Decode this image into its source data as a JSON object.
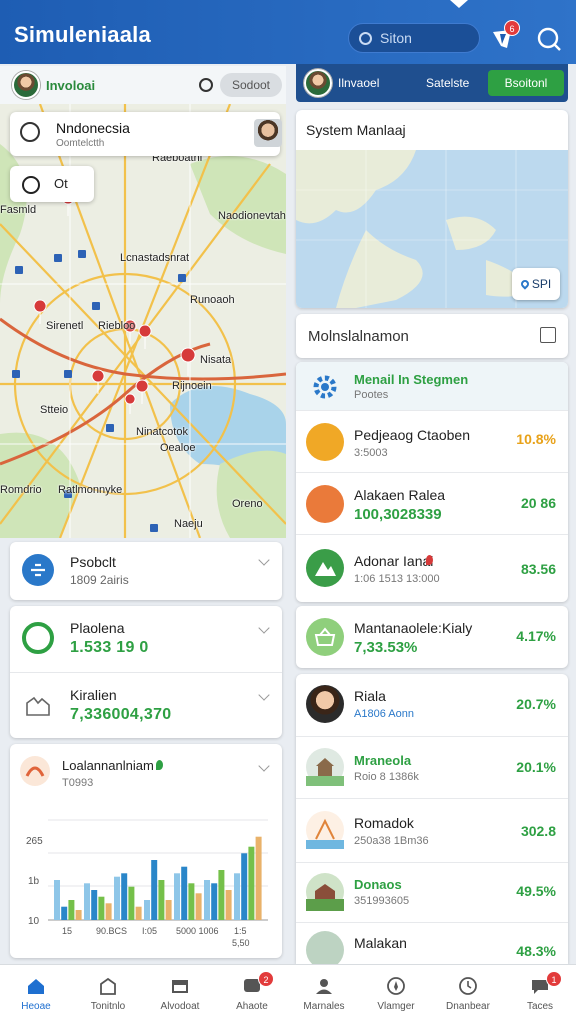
{
  "header": {
    "title": "Simuleniaala",
    "search_placeholder": "Siton",
    "notif_count": "6"
  },
  "left_top": {
    "user_name": "Involoai",
    "pill_label": "Sodoot"
  },
  "map": {
    "location_title": "Nndonecsia",
    "location_sub": "Oomtelctth",
    "mini_label": "Ot",
    "labels": [
      "Raeboathi",
      "Fasmld",
      "Naodionevtah",
      "Lcnastadsnrat",
      "Sirenetl",
      "Riebloo",
      "Runoaoh",
      "Nisata",
      "Rijnoein",
      "Ninatcotok",
      "Stteio",
      "Romdrio",
      "Ratlmonnyke",
      "Naeju",
      "Oealoe",
      "Oreno"
    ]
  },
  "left_cards": [
    {
      "title": "Psobclt",
      "sub": "1809 2airis"
    },
    {
      "title": "Plaolena",
      "value": "1.533 19 0"
    },
    {
      "title": "Kiralien",
      "value": "7,336004,370"
    }
  ],
  "chart_card": {
    "title": "Loalannanlniam",
    "sub": "T0993",
    "y_ticks": [
      "265",
      "1b",
      "10"
    ],
    "x_ticks": [
      "15",
      "90.BCS",
      "I:05",
      "5000 1006",
      "1:5",
      "5,50"
    ]
  },
  "right_top": {
    "user": "Ilnvaoel",
    "label": "Satelste",
    "button": "Bsoitonl"
  },
  "system_map": {
    "title": "System Manlaaj",
    "pill": "SPI"
  },
  "monitoring": {
    "title": "Molnslalnamon",
    "header_row": {
      "title": "Menail In Stegmen",
      "sub": "Pootes"
    },
    "rows": [
      {
        "title": "Pedjeaog Ctaoben",
        "sub": "3:5003",
        "pct": "10.8%",
        "pct_color": "#e8a21a",
        "icon_color": "#f0a826"
      },
      {
        "title": "Alakaen Ralea",
        "value": "100,3028339",
        "pct": "20 86",
        "pct_color": "#2ea043",
        "icon_color": "#ea7a3a"
      },
      {
        "title": "Adonar Ianai",
        "sub": "1:06 1513 13:000",
        "pct": "83.56",
        "pct_color": "#2ea043",
        "icon_color": "#3a9d48"
      }
    ]
  },
  "single_card": {
    "title": "Mantanaolele:Kialy",
    "value": "7,33.53%",
    "pct": "4.17%"
  },
  "people": [
    {
      "title": "Riala",
      "sub": "A1806 Aonn",
      "pct": "20.7%"
    },
    {
      "title": "Mraneola",
      "sub": "Roio 8 1386k",
      "pct": "20.1%"
    },
    {
      "title": "Romadok",
      "sub": "250a38 1Bm36",
      "pct": "302.8"
    },
    {
      "title": "Donaos",
      "sub": "351993605",
      "pct": "49.5%"
    },
    {
      "title": "Malakan",
      "sub": "",
      "pct": "48.3%"
    }
  ],
  "nav": [
    {
      "label": "Heoae",
      "active": true
    },
    {
      "label": "Tonitnlo"
    },
    {
      "label": "Alvodoat"
    },
    {
      "label": "Ahaote",
      "badge": "2"
    },
    {
      "label": "Marnales"
    },
    {
      "label": "Vlamger"
    },
    {
      "label": "Dnanbear"
    },
    {
      "label": "Taces",
      "badge": "1"
    }
  ],
  "chart_data": {
    "type": "bar",
    "categories": [
      "15",
      "90.BCS",
      "I:05",
      "5000 1006",
      "1:5",
      "5,50"
    ],
    "series": [
      {
        "values": [
          12,
          11,
          13,
          6,
          14,
          12,
          14
        ]
      },
      {
        "values": [
          4,
          9,
          14,
          18,
          16,
          11,
          20
        ]
      },
      {
        "values": [
          6,
          7,
          10,
          12,
          11,
          15,
          22
        ]
      },
      {
        "values": [
          3,
          5,
          4,
          6,
          8,
          9,
          25
        ]
      }
    ],
    "ylim": [
      0,
      30
    ],
    "grid": true,
    "colors": [
      "#8ec6e8",
      "#2a86c9",
      "#75c04a",
      "#e9b26a"
    ]
  }
}
